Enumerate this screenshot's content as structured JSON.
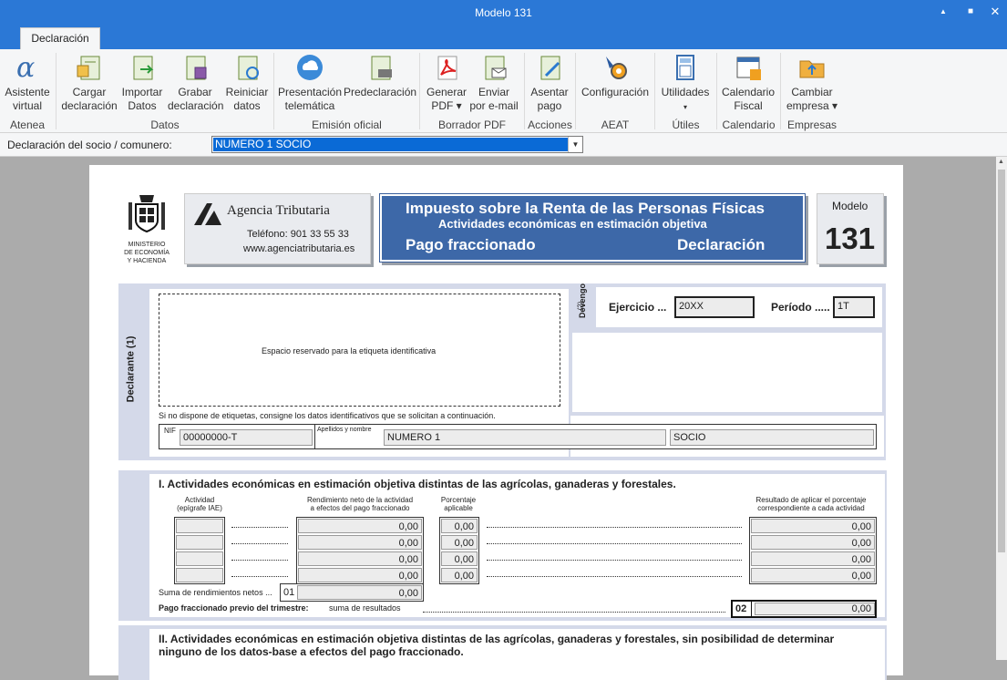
{
  "window": {
    "title": "Modelo 131",
    "minimize": "▲",
    "maximize": "■",
    "close": "✕"
  },
  "tab": "Declaración",
  "ribbon": {
    "buttons": [
      {
        "l1": "Asistente",
        "l2": "virtual"
      },
      {
        "l1": "Cargar",
        "l2": "declaración"
      },
      {
        "l1": "Importar",
        "l2": "Datos"
      },
      {
        "l1": "Grabar",
        "l2": "declaración"
      },
      {
        "l1": "Reiniciar",
        "l2": "datos"
      },
      {
        "l1": "Presentación",
        "l2": "telemática"
      },
      {
        "l1": "Predeclaración",
        "l2": ""
      },
      {
        "l1": "Generar",
        "l2": "PDF ▾"
      },
      {
        "l1": "Enviar",
        "l2": "por e-mail"
      },
      {
        "l1": "Asentar",
        "l2": "pago"
      },
      {
        "l1": "Configuración",
        "l2": ""
      },
      {
        "l1": "Utilidades",
        "l2": "▾"
      },
      {
        "l1": "Calendario",
        "l2": "Fiscal"
      },
      {
        "l1": "Cambiar",
        "l2": "empresa ▾"
      }
    ],
    "groups": [
      "Atenea",
      "Datos",
      "Emisión oficial",
      "Borrador PDF",
      "Acciones",
      "AEAT",
      "Útiles",
      "Calendario",
      "Empresas"
    ]
  },
  "selector": {
    "label": "Declaración del socio / comunero:",
    "value": "NUMERO 1 SOCIO",
    "arrow": "▼"
  },
  "form": {
    "ministry": "MINISTERIO\nDE ECONOMÍA\nY HACIENDA",
    "agency": {
      "name": "Agencia Tributaria",
      "phone": "Teléfono: 901 33 55 33",
      "web": "www.agenciatributaria.es"
    },
    "banner": {
      "title": "Impuesto sobre la Renta de las Personas Físicas",
      "subtitle": "Actividades económicas en estimación objetiva",
      "left": "Pago fraccionado",
      "right": "Declaración"
    },
    "modelo": {
      "label": "Modelo",
      "number": "131"
    },
    "declarante": {
      "side": "Declarante (1)",
      "label_space": "Espacio reservado para la etiqueta identificativa",
      "note": "Si no dispone de etiquetas, consigne los datos identificativos que se solicitan a continuación.",
      "nif_label": "NIF",
      "nif": "00000000-T",
      "name_label": "Apellidos y nombre",
      "surname": "NUMERO 1",
      "name": "SOCIO"
    },
    "devengo": {
      "side": "Devengo",
      "side2": "(2)",
      "ejercicio_label": "Ejercicio ...",
      "ejercicio": "20XX",
      "periodo_label": "Período .....",
      "periodo": "1T"
    },
    "section1": {
      "title": "I.  Actividades económicas en estimación objetiva distintas de las agrícolas, ganaderas y forestales.",
      "h_actividad": "Actividad\n(epígrafe IAE)",
      "h_rend": "Rendimiento neto de la actividad\na efectos del pago fraccionado",
      "h_porc": "Porcentaje\naplicable",
      "h_res": "Resultado de aplicar el porcentaje\ncorrespondiente a cada actividad",
      "rows": [
        {
          "rend": "0,00",
          "porc": "0,00",
          "res": "0,00"
        },
        {
          "rend": "0,00",
          "porc": "0,00",
          "res": "0,00"
        },
        {
          "rend": "0,00",
          "porc": "0,00",
          "res": "0,00"
        },
        {
          "rend": "0,00",
          "porc": "0,00",
          "res": "0,00"
        }
      ],
      "suma_label": "Suma de rendimientos netos ...",
      "suma_box": "01",
      "suma": "0,00",
      "pago_label": "Pago fraccionado previo del trimestre:",
      "pago_label2": "suma de resultados",
      "pago_box": "02",
      "pago": "0,00"
    },
    "section2": {
      "line1": "II.  Actividades económicas en estimación objetiva distintas de las agrícolas, ganaderas y forestales, sin posibilidad de determinar",
      "line2": "ninguno de los datos-base a efectos del pago fraccionado."
    }
  }
}
